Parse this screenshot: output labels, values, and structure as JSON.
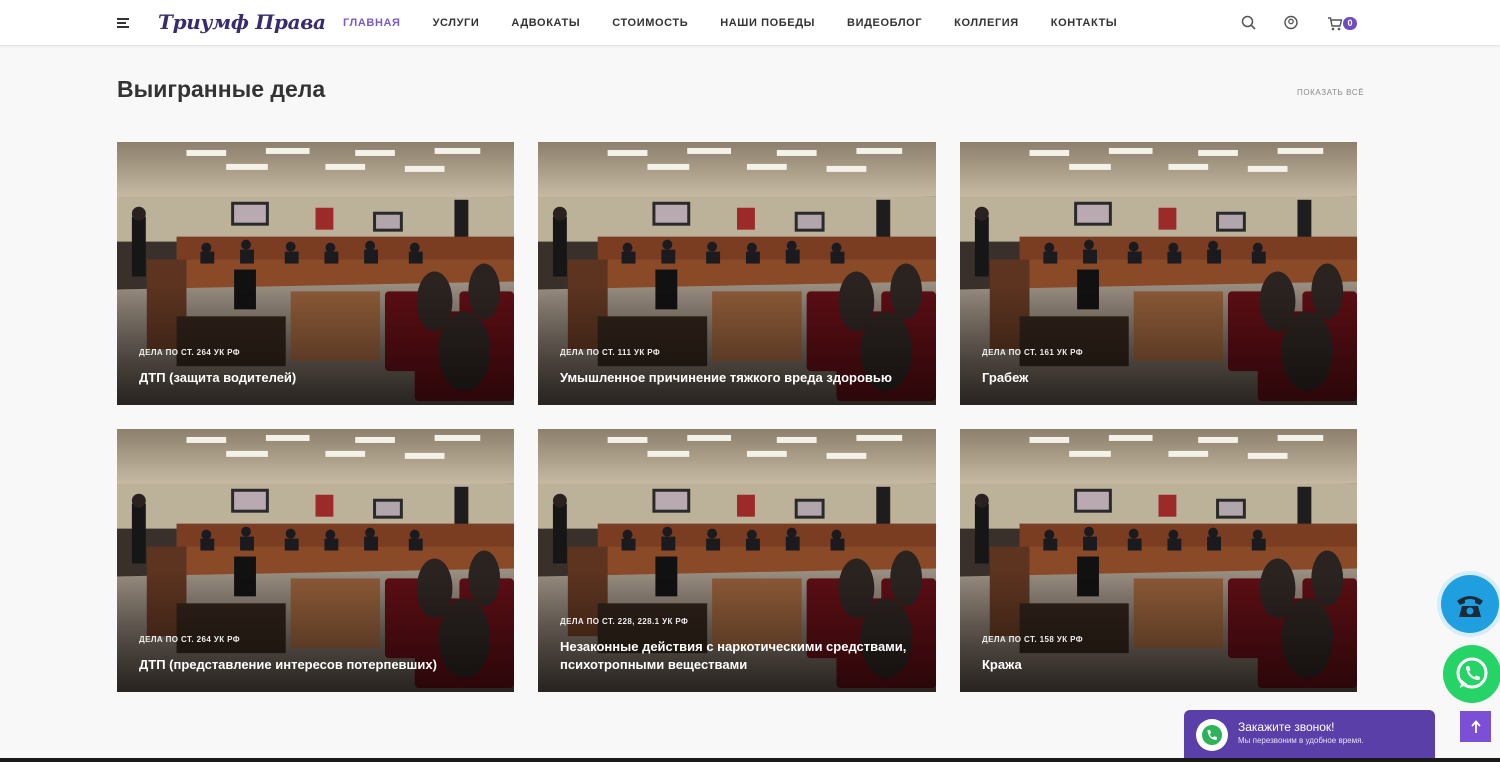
{
  "header": {
    "logo": "Триумф Права",
    "nav": [
      {
        "label": "ГЛАВНАЯ",
        "active": true
      },
      {
        "label": "УСЛУГИ",
        "active": false
      },
      {
        "label": "АДВОКАТЫ",
        "active": false
      },
      {
        "label": "СТОИМОСТЬ",
        "active": false
      },
      {
        "label": "НАШИ ПОБЕДЫ",
        "active": false
      },
      {
        "label": "ВИДЕОБЛОГ",
        "active": false
      },
      {
        "label": "КОЛЛЕГИЯ",
        "active": false
      },
      {
        "label": "КОНТАКТЫ",
        "active": false
      }
    ],
    "icons": [
      "menu-icon",
      "search-icon",
      "user-icon",
      "cart-icon"
    ],
    "cart_count": "0"
  },
  "section": {
    "title": "Выигранные дела",
    "show_all": "ПОКАЗАТЬ ВСЁ"
  },
  "cases": [
    {
      "category": "ДЕЛА ПО СТ. 264 УК РФ",
      "title": "ДТП (защита водителей)"
    },
    {
      "category": "ДЕЛА ПО СТ. 111 УК РФ",
      "title": "Умышленное причинение тяжкого вреда здоровью"
    },
    {
      "category": "ДЕЛА ПО СТ. 161 УК РФ",
      "title": "Грабеж"
    },
    {
      "category": "ДЕЛА ПО СТ. 264 УК РФ",
      "title": "ДТП (представление интересов потерпевших)"
    },
    {
      "category": "ДЕЛА ПО СТ. 228, 228.1 УК РФ",
      "title": "Незаконные действия с наркотическими средствами, психотропными веществами"
    },
    {
      "category": "ДЕЛА ПО СТ. 158 УК РФ",
      "title": "Кража"
    }
  ],
  "callback": {
    "title": "Закажите звонок!",
    "subtitle": "Мы перезвоним в удобное время."
  },
  "colors": {
    "accent": "#7b59c6",
    "logo": "#3a2a6e",
    "callback_bg": "#5b3fa8",
    "whatsapp": "#25d366",
    "phone": "#1f9fe0"
  }
}
